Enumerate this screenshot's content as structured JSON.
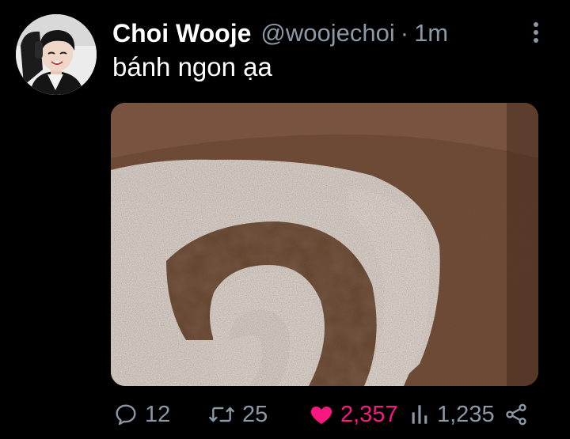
{
  "tweet": {
    "display_name": "Choi Wooje",
    "handle": "@woojechoi",
    "separator": "·",
    "time": "1m",
    "text": "bánh ngon ạa",
    "more_icon": "more-vertical-icon",
    "media_description_icon": "photo"
  },
  "actions": {
    "reply": {
      "icon": "reply-icon",
      "count": "12"
    },
    "retweet": {
      "icon": "retweet-icon",
      "count": "25"
    },
    "like": {
      "icon": "heart-icon",
      "count": "2,357",
      "liked": true
    },
    "views": {
      "icon": "views-icon",
      "count": "1,235"
    },
    "share": {
      "icon": "share-icon"
    }
  },
  "colors": {
    "background": "#000000",
    "name": "#ffffff",
    "muted": "#8b98a5",
    "like": "#f91880"
  }
}
